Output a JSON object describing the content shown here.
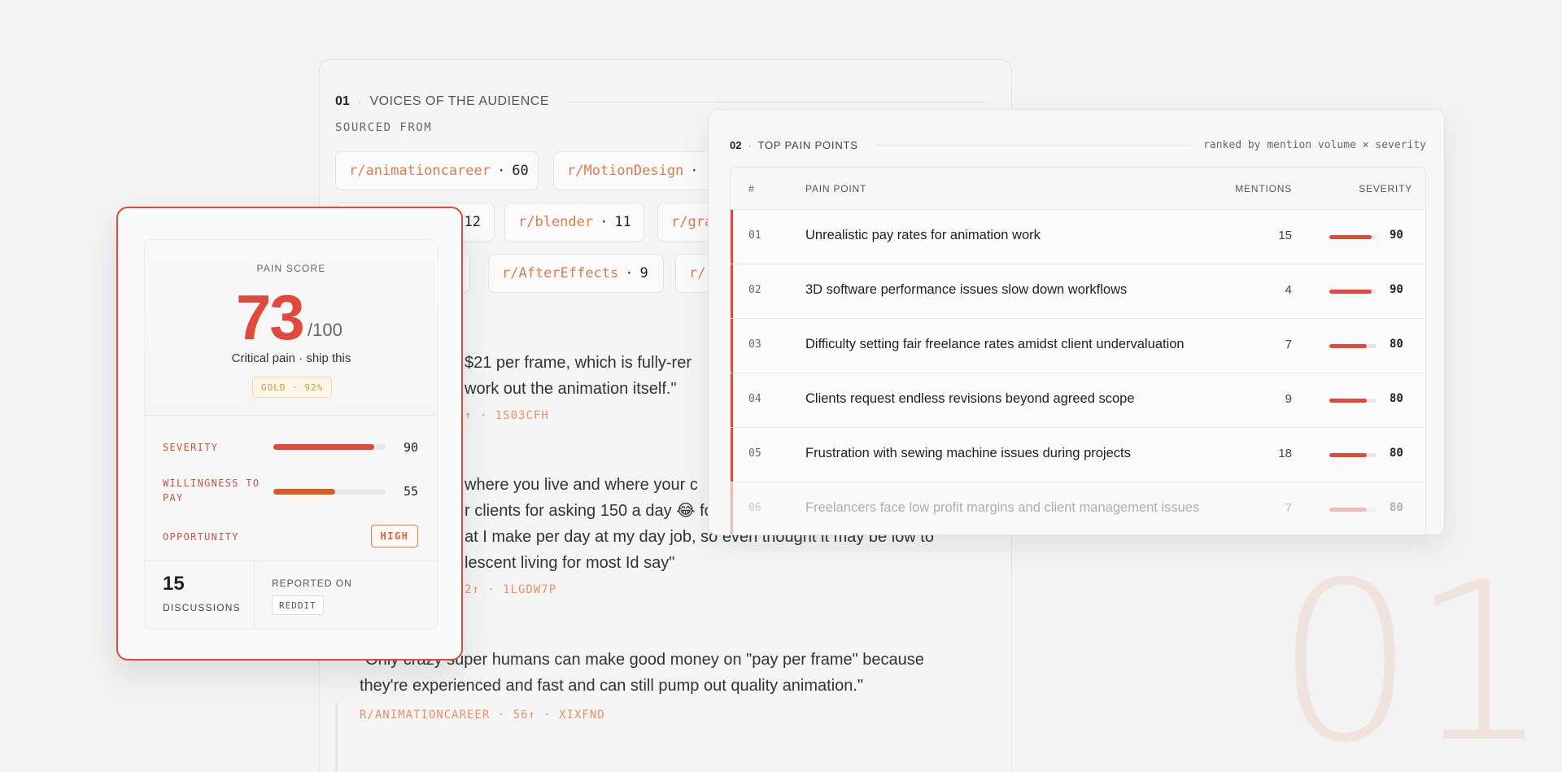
{
  "watermark": "01",
  "voices": {
    "section_num": "01",
    "section_sep": "·",
    "section_title": "VOICES OF THE AUDIENCE",
    "sourced_label": "SOURCED FROM",
    "chips": [
      {
        "sub": "r/animationcareer",
        "count": "60"
      },
      {
        "sub": "r/MotionDesign",
        "count": ""
      },
      {
        "sub": "",
        "count": "12"
      },
      {
        "sub": "r/blender",
        "count": "11"
      },
      {
        "sub": "r/gra",
        "count": ""
      },
      {
        "sub": "r/AfterEffects",
        "count": "9"
      },
      {
        "sub": "r/",
        "count": ""
      }
    ],
    "quotes": [
      {
        "lines": [
          "$21 per frame, which is fully-rer",
          "work out the animation itself.\""
        ],
        "meta": "↑ · 1S03CFH"
      },
      {
        "lines": [
          "where you live and where your c",
          "r clients for asking 150 a day 😂 fo",
          "at I make per day at my day job, so even thought it may be low to",
          "lescent living for most Id say\""
        ],
        "meta": "2↑ · 1LGDW7P"
      },
      {
        "lines": [
          "\"Only crazy super humans can make good money on \"pay per frame\" because",
          "they're experienced and fast and can still pump out quality animation.\""
        ],
        "meta": "R/ANIMATIONCAREER · 56↑ · XIXFND"
      }
    ]
  },
  "score": {
    "label": "PAIN SCORE",
    "value": "73",
    "out_of": "/100",
    "verdict": "Critical pain · ship this",
    "tier": "GOLD · 92%",
    "metrics": [
      {
        "label": "SEVERITY",
        "value": "90",
        "fraction": 0.9,
        "color": "#e04a3c"
      },
      {
        "label": "WILLINGNESS TO PAY",
        "value": "55",
        "fraction": 0.55,
        "color": "#e05a1f"
      }
    ],
    "opportunity_label": "OPPORTUNITY",
    "opportunity_value": "HIGH",
    "discussions_count": "15",
    "discussions_label": "DISCUSSIONS",
    "reported_label": "REPORTED ON",
    "reported_source": "REDDIT"
  },
  "pain": {
    "section_num": "02",
    "section_sep": "·",
    "section_title": "TOP PAIN POINTS",
    "rank_note": "ranked by mention volume × severity",
    "headers": {
      "num": "#",
      "point": "PAIN POINT",
      "mentions": "MENTIONS",
      "severity": "SEVERITY"
    },
    "rows": [
      {
        "idx": "01",
        "text": "Unrealistic pay rates for animation work",
        "mentions": "15",
        "severity": "90",
        "fraction": 0.9
      },
      {
        "idx": "02",
        "text": "3D software performance issues slow down workflows",
        "mentions": "4",
        "severity": "90",
        "fraction": 0.9
      },
      {
        "idx": "03",
        "text": "Difficulty setting fair freelance rates amidst client undervaluation",
        "mentions": "7",
        "severity": "80",
        "fraction": 0.8
      },
      {
        "idx": "04",
        "text": "Clients request endless revisions beyond agreed scope",
        "mentions": "9",
        "severity": "80",
        "fraction": 0.8
      },
      {
        "idx": "05",
        "text": "Frustration with sewing machine issues during projects",
        "mentions": "18",
        "severity": "80",
        "fraction": 0.8
      },
      {
        "idx": "06",
        "text": "Freelancers face low profit margins and client management issues",
        "mentions": "7",
        "severity": "80",
        "fraction": 0.8
      }
    ]
  }
}
